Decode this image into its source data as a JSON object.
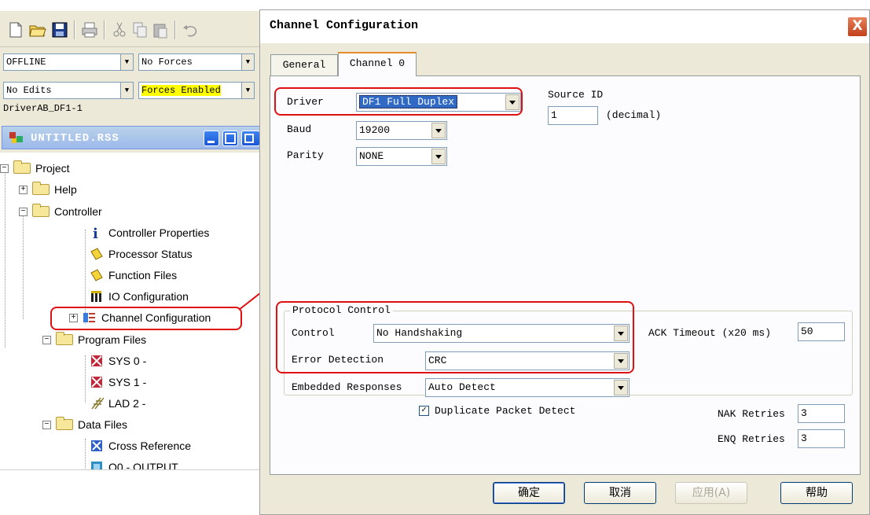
{
  "left": {
    "status_combos": [
      {
        "value": "OFFLINE"
      },
      {
        "value": "No Forces"
      },
      {
        "value": "No Edits"
      },
      {
        "value": "Forces Enabled"
      }
    ],
    "driver_name": "DriverAB_DF1-1",
    "project_title": "UNTITLED.RSS",
    "tree": {
      "project": "Project",
      "help": "Help",
      "controller": "Controller",
      "controller_properties": "Controller Properties",
      "processor_status": "Processor Status",
      "function_files": "Function Files",
      "io_configuration": "IO Configuration",
      "channel_configuration": "Channel Configuration",
      "program_files": "Program Files",
      "sys0": "SYS 0 -",
      "sys1": "SYS 1 -",
      "lad2": "LAD 2 -",
      "data_files": "Data Files",
      "cross_reference": "Cross Reference",
      "o0_output": "O0 - OUTPUT"
    }
  },
  "dialog": {
    "title": "Channel Configuration",
    "close_glyph": "X",
    "tabs": [
      {
        "label": "General"
      },
      {
        "label": "Channel 0",
        "active": true
      }
    ],
    "driver_label": "Driver",
    "driver_value": "DF1 Full Duplex",
    "baud_label": "Baud",
    "baud_value": "19200",
    "parity_label": "Parity",
    "parity_value": "NONE",
    "source_id_label": "Source ID",
    "source_id_value": "1",
    "source_id_unit": "(decimal)",
    "protocol_group_title": "Protocol Control",
    "control_label": "Control",
    "control_value": "No Handshaking",
    "error_detection_label": "Error Detection",
    "error_detection_value": "CRC",
    "embedded_label": "Embedded Responses",
    "embedded_value": "Auto Detect",
    "dup_packet_label": "Duplicate Packet Detect",
    "dup_packet_checked": true,
    "ack_timeout_label": "ACK Timeout (x20 ms)",
    "ack_timeout_value": "50",
    "nak_label": "NAK Retries",
    "nak_value": "3",
    "enq_label": "ENQ Retries",
    "enq_value": "3",
    "buttons": {
      "ok": "确定",
      "cancel": "取消",
      "apply": "应用(A)",
      "help": "帮助"
    }
  },
  "colors": {
    "highlight_red": "#e01010",
    "forces_enabled_bg": "#ffff00",
    "selection_blue": "#316ac5"
  }
}
